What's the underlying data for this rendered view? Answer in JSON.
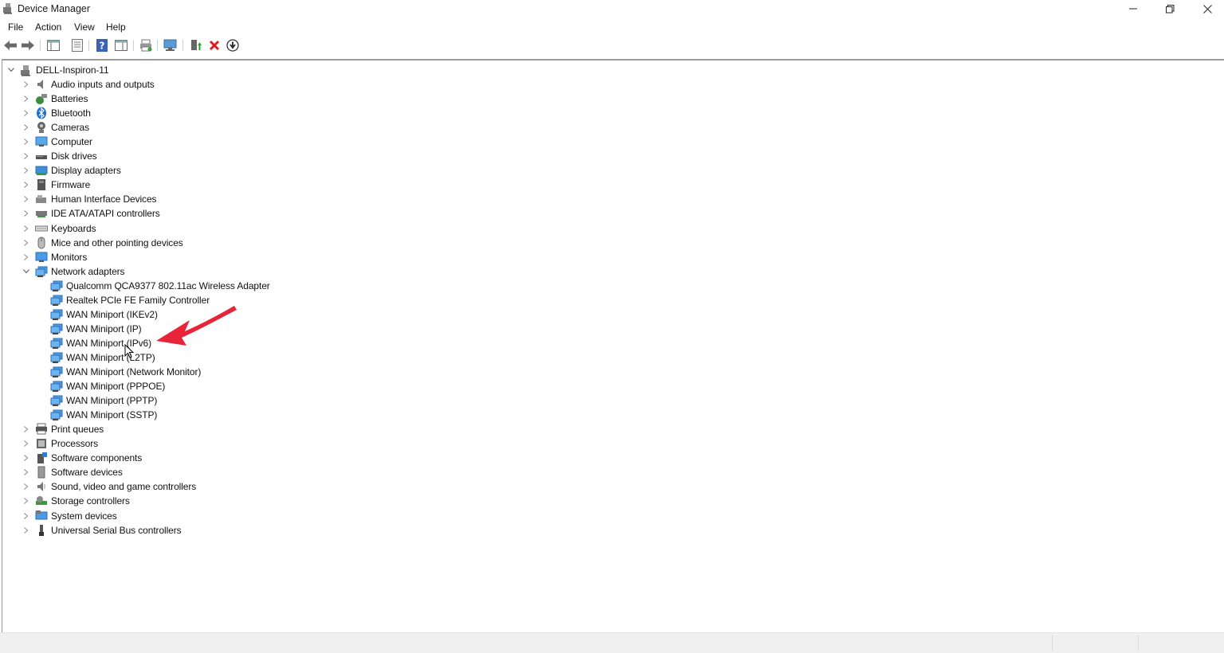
{
  "window": {
    "title": "Device Manager",
    "controls": {
      "minimize": "minimize",
      "maximize": "restore",
      "close": "close"
    }
  },
  "menubar": {
    "items": [
      {
        "label": "File"
      },
      {
        "label": "Action"
      },
      {
        "label": "View"
      },
      {
        "label": "Help"
      }
    ]
  },
  "toolbar": {
    "buttons": [
      {
        "name": "back-icon"
      },
      {
        "name": "forward-icon"
      },
      {
        "name": "show-hide-console-tree-icon"
      },
      {
        "name": "properties-icon"
      },
      {
        "name": "help-icon"
      },
      {
        "name": "action-pane-icon"
      },
      {
        "name": "print-icon"
      },
      {
        "name": "scan-hardware-icon"
      },
      {
        "name": "update-driver-icon"
      },
      {
        "name": "uninstall-device-icon"
      },
      {
        "name": "disable-device-icon"
      }
    ]
  },
  "tree": {
    "root": {
      "label": "DELL-Inspiron-11",
      "expanded": true
    },
    "categories": [
      {
        "label": "Audio inputs and outputs",
        "icon": "speaker-icon"
      },
      {
        "label": "Batteries",
        "icon": "battery-icon"
      },
      {
        "label": "Bluetooth",
        "icon": "bluetooth-icon"
      },
      {
        "label": "Cameras",
        "icon": "camera-icon"
      },
      {
        "label": "Computer",
        "icon": "computer-icon"
      },
      {
        "label": "Disk drives",
        "icon": "disk-drive-icon"
      },
      {
        "label": "Display adapters",
        "icon": "display-adapter-icon"
      },
      {
        "label": "Firmware",
        "icon": "firmware-icon"
      },
      {
        "label": "Human Interface Devices",
        "icon": "hid-icon"
      },
      {
        "label": "IDE ATA/ATAPI controllers",
        "icon": "ide-controller-icon"
      },
      {
        "label": "Keyboards",
        "icon": "keyboard-icon"
      },
      {
        "label": "Mice and other pointing devices",
        "icon": "mouse-icon"
      },
      {
        "label": "Monitors",
        "icon": "monitor-icon"
      },
      {
        "label": "Network adapters",
        "icon": "network-adapter-icon",
        "expanded": true
      },
      {
        "label": "Print queues",
        "icon": "printer-icon"
      },
      {
        "label": "Processors",
        "icon": "processor-icon"
      },
      {
        "label": "Software components",
        "icon": "software-component-icon"
      },
      {
        "label": "Software devices",
        "icon": "software-device-icon"
      },
      {
        "label": "Sound, video and game controllers",
        "icon": "sound-controller-icon"
      },
      {
        "label": "Storage controllers",
        "icon": "storage-controller-icon"
      },
      {
        "label": "System devices",
        "icon": "system-device-icon"
      },
      {
        "label": "Universal Serial Bus controllers",
        "icon": "usb-icon"
      }
    ],
    "network_children": [
      {
        "label": "Qualcomm QCA9377 802.11ac Wireless Adapter"
      },
      {
        "label": "Realtek PCIe FE Family Controller"
      },
      {
        "label": "WAN Miniport (IKEv2)"
      },
      {
        "label": "WAN Miniport (IP)"
      },
      {
        "label": "WAN Miniport (IPv6)"
      },
      {
        "label": "WAN Miniport (L2TP)"
      },
      {
        "label": "WAN Miniport (Network Monitor)"
      },
      {
        "label": "WAN Miniport (PPPOE)"
      },
      {
        "label": "WAN Miniport (PPTP)"
      },
      {
        "label": "WAN Miniport (SSTP)"
      }
    ]
  },
  "annotation": {
    "color": "#e8243a",
    "target": "WAN Miniport (IPv6)"
  },
  "colors": {
    "network_icon": "#3a8ee6",
    "tree_line": "#9a9a9a",
    "uninstall_red": "#e01b1b",
    "update_green": "#2e9e2e"
  }
}
